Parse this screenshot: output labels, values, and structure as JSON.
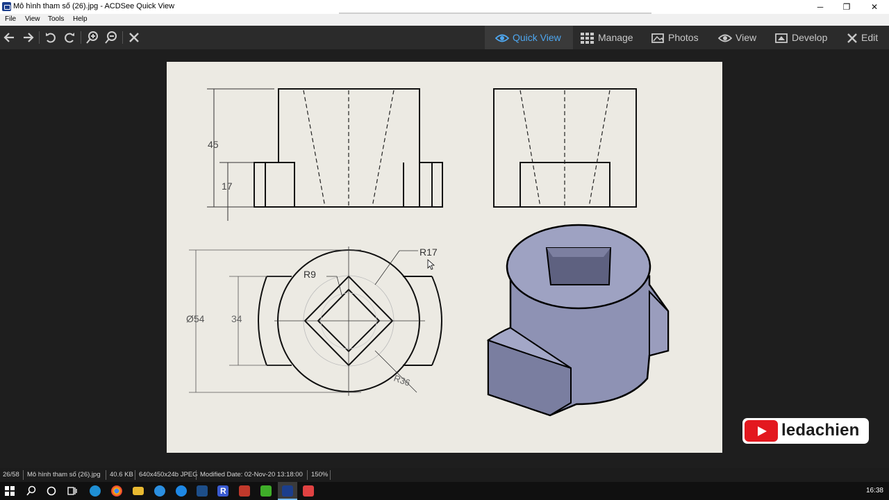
{
  "window": {
    "title": "Mô hình tham số (26).jpg - ACDSee Quick View",
    "minimize": "─",
    "restore": "❐",
    "close": "✕"
  },
  "menu": [
    "File",
    "View",
    "Tools",
    "Help"
  ],
  "toolbar": {
    "modes": [
      {
        "label": "Quick View",
        "icon": "eye-icon",
        "active": true
      },
      {
        "label": "Manage",
        "icon": "grid-icon",
        "active": false
      },
      {
        "label": "Photos",
        "icon": "photos-icon",
        "active": false
      },
      {
        "label": "View",
        "icon": "eye-icon",
        "active": false
      },
      {
        "label": "Develop",
        "icon": "develop-icon",
        "active": false
      },
      {
        "label": "Edit",
        "icon": "edit-icon",
        "active": false
      }
    ]
  },
  "drawing": {
    "dim_45": "45",
    "dim_17": "17",
    "dim_r17": "R17",
    "dim_r9": "R9",
    "dim_phi54": "Ø54",
    "dim_34": "34",
    "dim_r36": "R36"
  },
  "watermark": {
    "name": "ledachien"
  },
  "status": {
    "index": "26/58",
    "filename": "Mô hình tham số (26).jpg",
    "filesize": "40.6 KB",
    "format": "640x450x24b JPEG",
    "modified": "Modified Date: 02-Nov-20 13:18:00",
    "zoom": "150%"
  },
  "taskbar": {
    "time": "16:38"
  },
  "colors": {
    "accent": "#4ea7f0",
    "youtube": "#e3181f",
    "paper": "#eceae3",
    "solid": "#8e92b4"
  }
}
